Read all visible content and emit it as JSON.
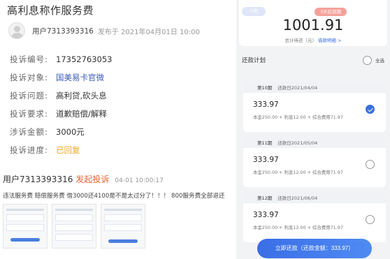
{
  "complaint": {
    "title": "高利息称作服务费",
    "user": "用户7313393316",
    "published": "发布于 2021年04月01日 10:00",
    "fields": [
      {
        "label": "投诉编号:",
        "value": "17352763053",
        "style": ""
      },
      {
        "label": "投诉对象:",
        "value": "国美易卡官微",
        "style": "link"
      },
      {
        "label": "投诉问题:",
        "value": "高利贷,砍头息",
        "style": ""
      },
      {
        "label": "投诉要求:",
        "value": "道歉赔偿/解释",
        "style": ""
      },
      {
        "label": "涉诉金额:",
        "value": "3000元",
        "style": ""
      },
      {
        "label": "投诉进度:",
        "value": "已回复",
        "style": "orange"
      }
    ],
    "post": {
      "user": "用户7313393316",
      "action": "发起投诉",
      "time": "04-01 10:00:17",
      "text": "违法服务费 赔偿服务费 借3000还4100是不是太过分了！！！ 800服务费全部退还"
    }
  },
  "repayment": {
    "days_badge": "分期",
    "due_tag": "3天后到期",
    "total": "1001.91",
    "total_label": "总计待还（元）",
    "detail_link": "借款明细 >",
    "plan_label": "还款计划",
    "select_all": "全选",
    "periods": [
      {
        "name": "第10期",
        "date": "还款日2021/04/04",
        "amount": "333.97",
        "detail": "本金250.00 + 利息12.00 + 综合费用71.97",
        "checked": true
      },
      {
        "name": "第11期",
        "date": "还款日2021/05/04",
        "amount": "333.97",
        "detail": "本金250.00 + 利息12.00 + 综合费用71.97",
        "checked": false
      },
      {
        "name": "第12期",
        "date": "还款日2021/06/04",
        "amount": "333.97",
        "detail": "本金250.00 + 利息12.00 + 综合费用71.97",
        "checked": false
      }
    ],
    "pay_button": "立即还款（还款金额：333.97）"
  },
  "colors": {
    "accent": "#3b6fe0",
    "orange": "#f5a623",
    "post_action": "#f06030",
    "link": "#3b5bb5"
  }
}
